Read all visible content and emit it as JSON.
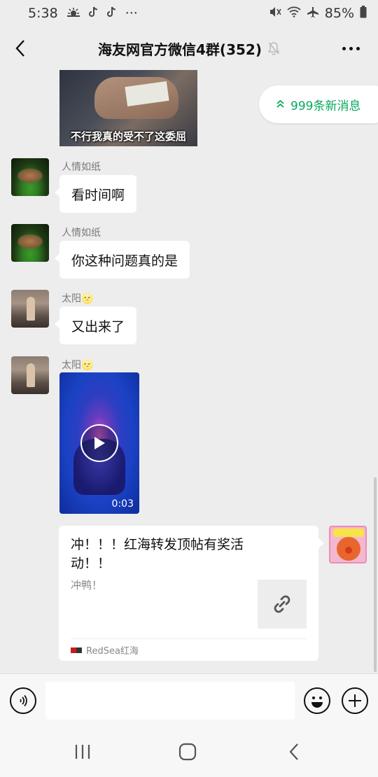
{
  "status_bar": {
    "time": "5:38",
    "dots": "···",
    "battery": "85%",
    "icons": [
      "weather-icon",
      "tiktok-icon",
      "tiktok-icon",
      "mute-icon",
      "wifi-icon",
      "airplane-icon",
      "battery-icon"
    ]
  },
  "header": {
    "title": "海友网官方微信4群(352)",
    "back_icon": "chevron-left-icon",
    "mute_icon": "bell-off-icon",
    "more_icon": "more-dots-icon"
  },
  "new_messages": {
    "label": "999条新消息",
    "color": "#07a85f"
  },
  "messages": [
    {
      "type": "image",
      "caption": "不行我真的受不了这委屈"
    },
    {
      "type": "text",
      "sender": "人情如纸",
      "text": "看时间啊"
    },
    {
      "type": "text",
      "sender": "人情如纸",
      "text": "你这种问题真的是"
    },
    {
      "type": "text",
      "sender": "太阳🌝",
      "text": "又出来了"
    },
    {
      "type": "video",
      "sender": "太阳🌝",
      "duration": "0:03"
    },
    {
      "type": "link",
      "title": "冲！！！红海转发顶帖有奖活动！！",
      "description": "冲鸭！",
      "source": "RedSea红海",
      "thumb_icon": "link-icon"
    }
  ],
  "input_bar": {
    "voice_icon": "voice-icon",
    "emoji_icon": "emoji-icon",
    "plus_icon": "plus-icon",
    "value": ""
  },
  "system_nav": {
    "icons": [
      "recent-apps-icon",
      "home-icon",
      "back-icon"
    ]
  }
}
